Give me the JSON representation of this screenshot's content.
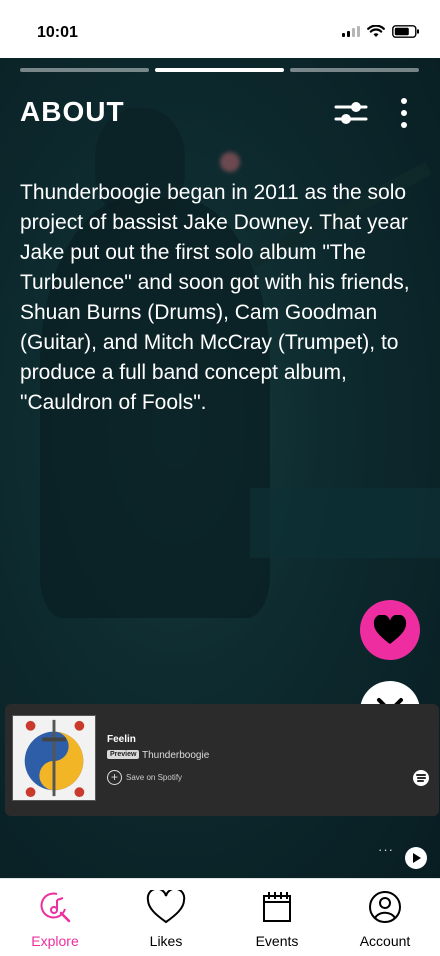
{
  "status_bar": {
    "time": "10:01"
  },
  "story": {
    "segments": [
      false,
      true,
      false
    ],
    "title": "ABOUT",
    "description": "Thunderboogie began in 2011 as the solo project of bassist Jake Downey. That year Jake put out the first solo album \"The Turbulence\" and soon got with his friends, Shuan Burns (Drums), Cam Goodman (Guitar), and Mitch McCray (Trumpet), to produce a full band concept album, \"Cauldron of Fools\"."
  },
  "actions": {
    "like_icon": "heart-icon",
    "dismiss_icon": "close-icon",
    "like_color": "#EE2EA0"
  },
  "player": {
    "track_title": "Feelin",
    "preview_label": "Preview",
    "artist": "Thunderboogie",
    "save_label": "Save on Spotify",
    "more_label": "···"
  },
  "tabs": [
    {
      "label": "Explore",
      "icon": "music-search-icon",
      "active": true
    },
    {
      "label": "Likes",
      "icon": "heart-outline-icon",
      "active": false
    },
    {
      "label": "Events",
      "icon": "calendar-icon",
      "active": false
    },
    {
      "label": "Account",
      "icon": "user-circle-icon",
      "active": false
    }
  ],
  "accent_color": "#EE2EA0"
}
